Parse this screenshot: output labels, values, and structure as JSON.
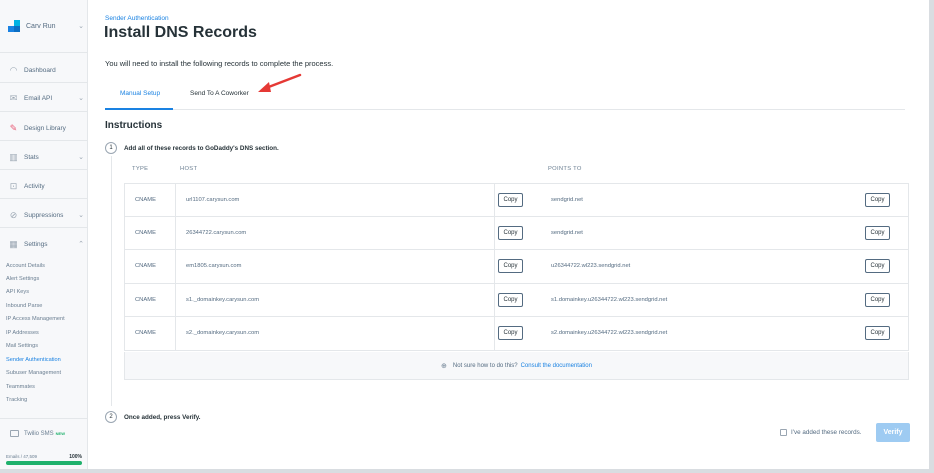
{
  "sidebar": {
    "account_name": "Carv Run",
    "nav": [
      {
        "label": "Dashboard",
        "icon": "dashboard-icon"
      },
      {
        "label": "Email API",
        "icon": "email-api-icon"
      },
      {
        "label": "Design Library",
        "icon": "design-library-icon"
      },
      {
        "label": "Stats",
        "icon": "stats-icon"
      },
      {
        "label": "Activity",
        "icon": "activity-icon"
      },
      {
        "label": "Suppressions",
        "icon": "suppressions-icon"
      },
      {
        "label": "Settings",
        "icon": "settings-icon"
      }
    ],
    "settings_items": [
      "Account Details",
      "Alert Settings",
      "API Keys",
      "Inbound Parse",
      "IP Access Management",
      "IP Addresses",
      "Mail Settings",
      "Sender Authentication",
      "Subuser Management",
      "Teammates",
      "Tracking"
    ],
    "twilio": {
      "label": "Twilio SMS",
      "badge": "NEW"
    },
    "usage": {
      "label": "Emails / 47,509",
      "percent_label": "100%",
      "percent": 100
    }
  },
  "header": {
    "eyebrow": "Sender Authentication",
    "title": "Install DNS Records",
    "intro": "You will need to install the following records to complete the process."
  },
  "tabs": [
    {
      "label": "Manual Setup",
      "active": true
    },
    {
      "label": "Send To A Coworker",
      "active": false
    }
  ],
  "instructions": {
    "heading": "Instructions",
    "step1": {
      "number": "1",
      "text": "Add all of these records to GoDaddy's DNS section."
    },
    "columns": {
      "type": "TYPE",
      "host": "HOST",
      "points_to": "POINTS TO"
    },
    "copy_label": "Copy",
    "records": [
      {
        "type": "CNAME",
        "host": "url1107.carysun.com",
        "points_to": "sendgrid.net"
      },
      {
        "type": "CNAME",
        "host": "26344722.carysun.com",
        "points_to": "sendgrid.net"
      },
      {
        "type": "CNAME",
        "host": "em1805.carysun.com",
        "points_to": "u26344722.wl223.sendgrid.net"
      },
      {
        "type": "CNAME",
        "host": "s1._domainkey.carysun.com",
        "points_to": "s1.domainkey.u26344722.wl223.sendgrid.net"
      },
      {
        "type": "CNAME",
        "host": "s2._domainkey.carysun.com",
        "points_to": "s2.domainkey.u26344722.wl223.sendgrid.net"
      }
    ],
    "help": {
      "text": "Not sure how to do this?",
      "link": "Consult the documentation"
    },
    "step2": {
      "number": "2",
      "text": "Once added, press Verify."
    },
    "confirm_label": "I've added these records.",
    "verify_label": "Verify"
  },
  "colors": {
    "accent": "#1a82e2",
    "verify_disabled": "#9ecbf2",
    "usage": "#1fb16c",
    "annotation_arrow": "#e53935"
  }
}
